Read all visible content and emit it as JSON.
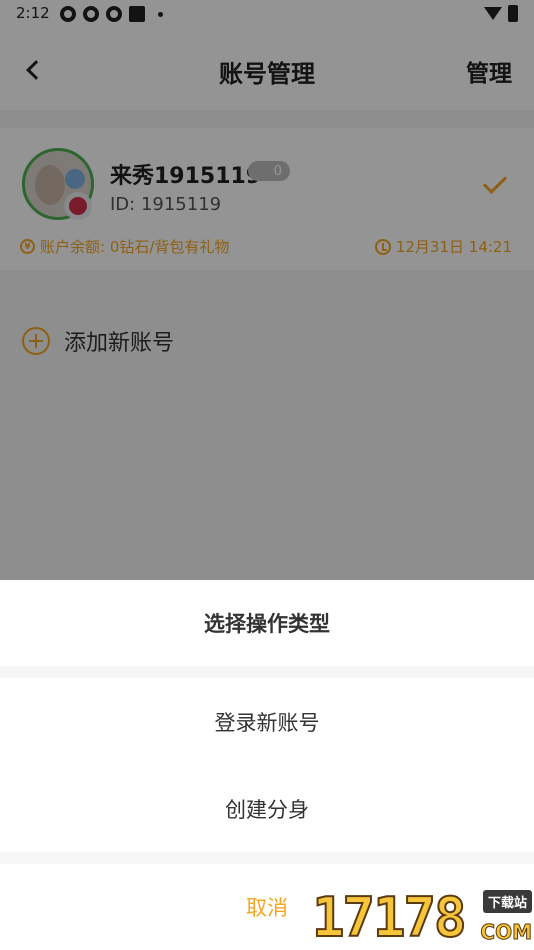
{
  "status_bar": {
    "time": "2:12"
  },
  "header": {
    "title": "账号管理",
    "manage_label": "管理"
  },
  "account": {
    "name": "来秀1915119",
    "level": "0",
    "id_text": "ID: 1915119",
    "balance_text": "账户余额: 0钻石/背包有礼物",
    "login_time": "12月31日 14:21",
    "coin_glyph": "¥"
  },
  "add_account": {
    "label": "添加新账号"
  },
  "sheet": {
    "title": "选择操作类型",
    "options": [
      {
        "label": "登录新账号"
      },
      {
        "label": "创建分身"
      }
    ],
    "cancel_label": "取消"
  },
  "watermark": {
    "digits": "17178",
    "tag": "下载站",
    "suffix": "COM"
  },
  "colors": {
    "accent": "#f5a623",
    "overlay": "rgba(0,0,0,0.42)"
  }
}
